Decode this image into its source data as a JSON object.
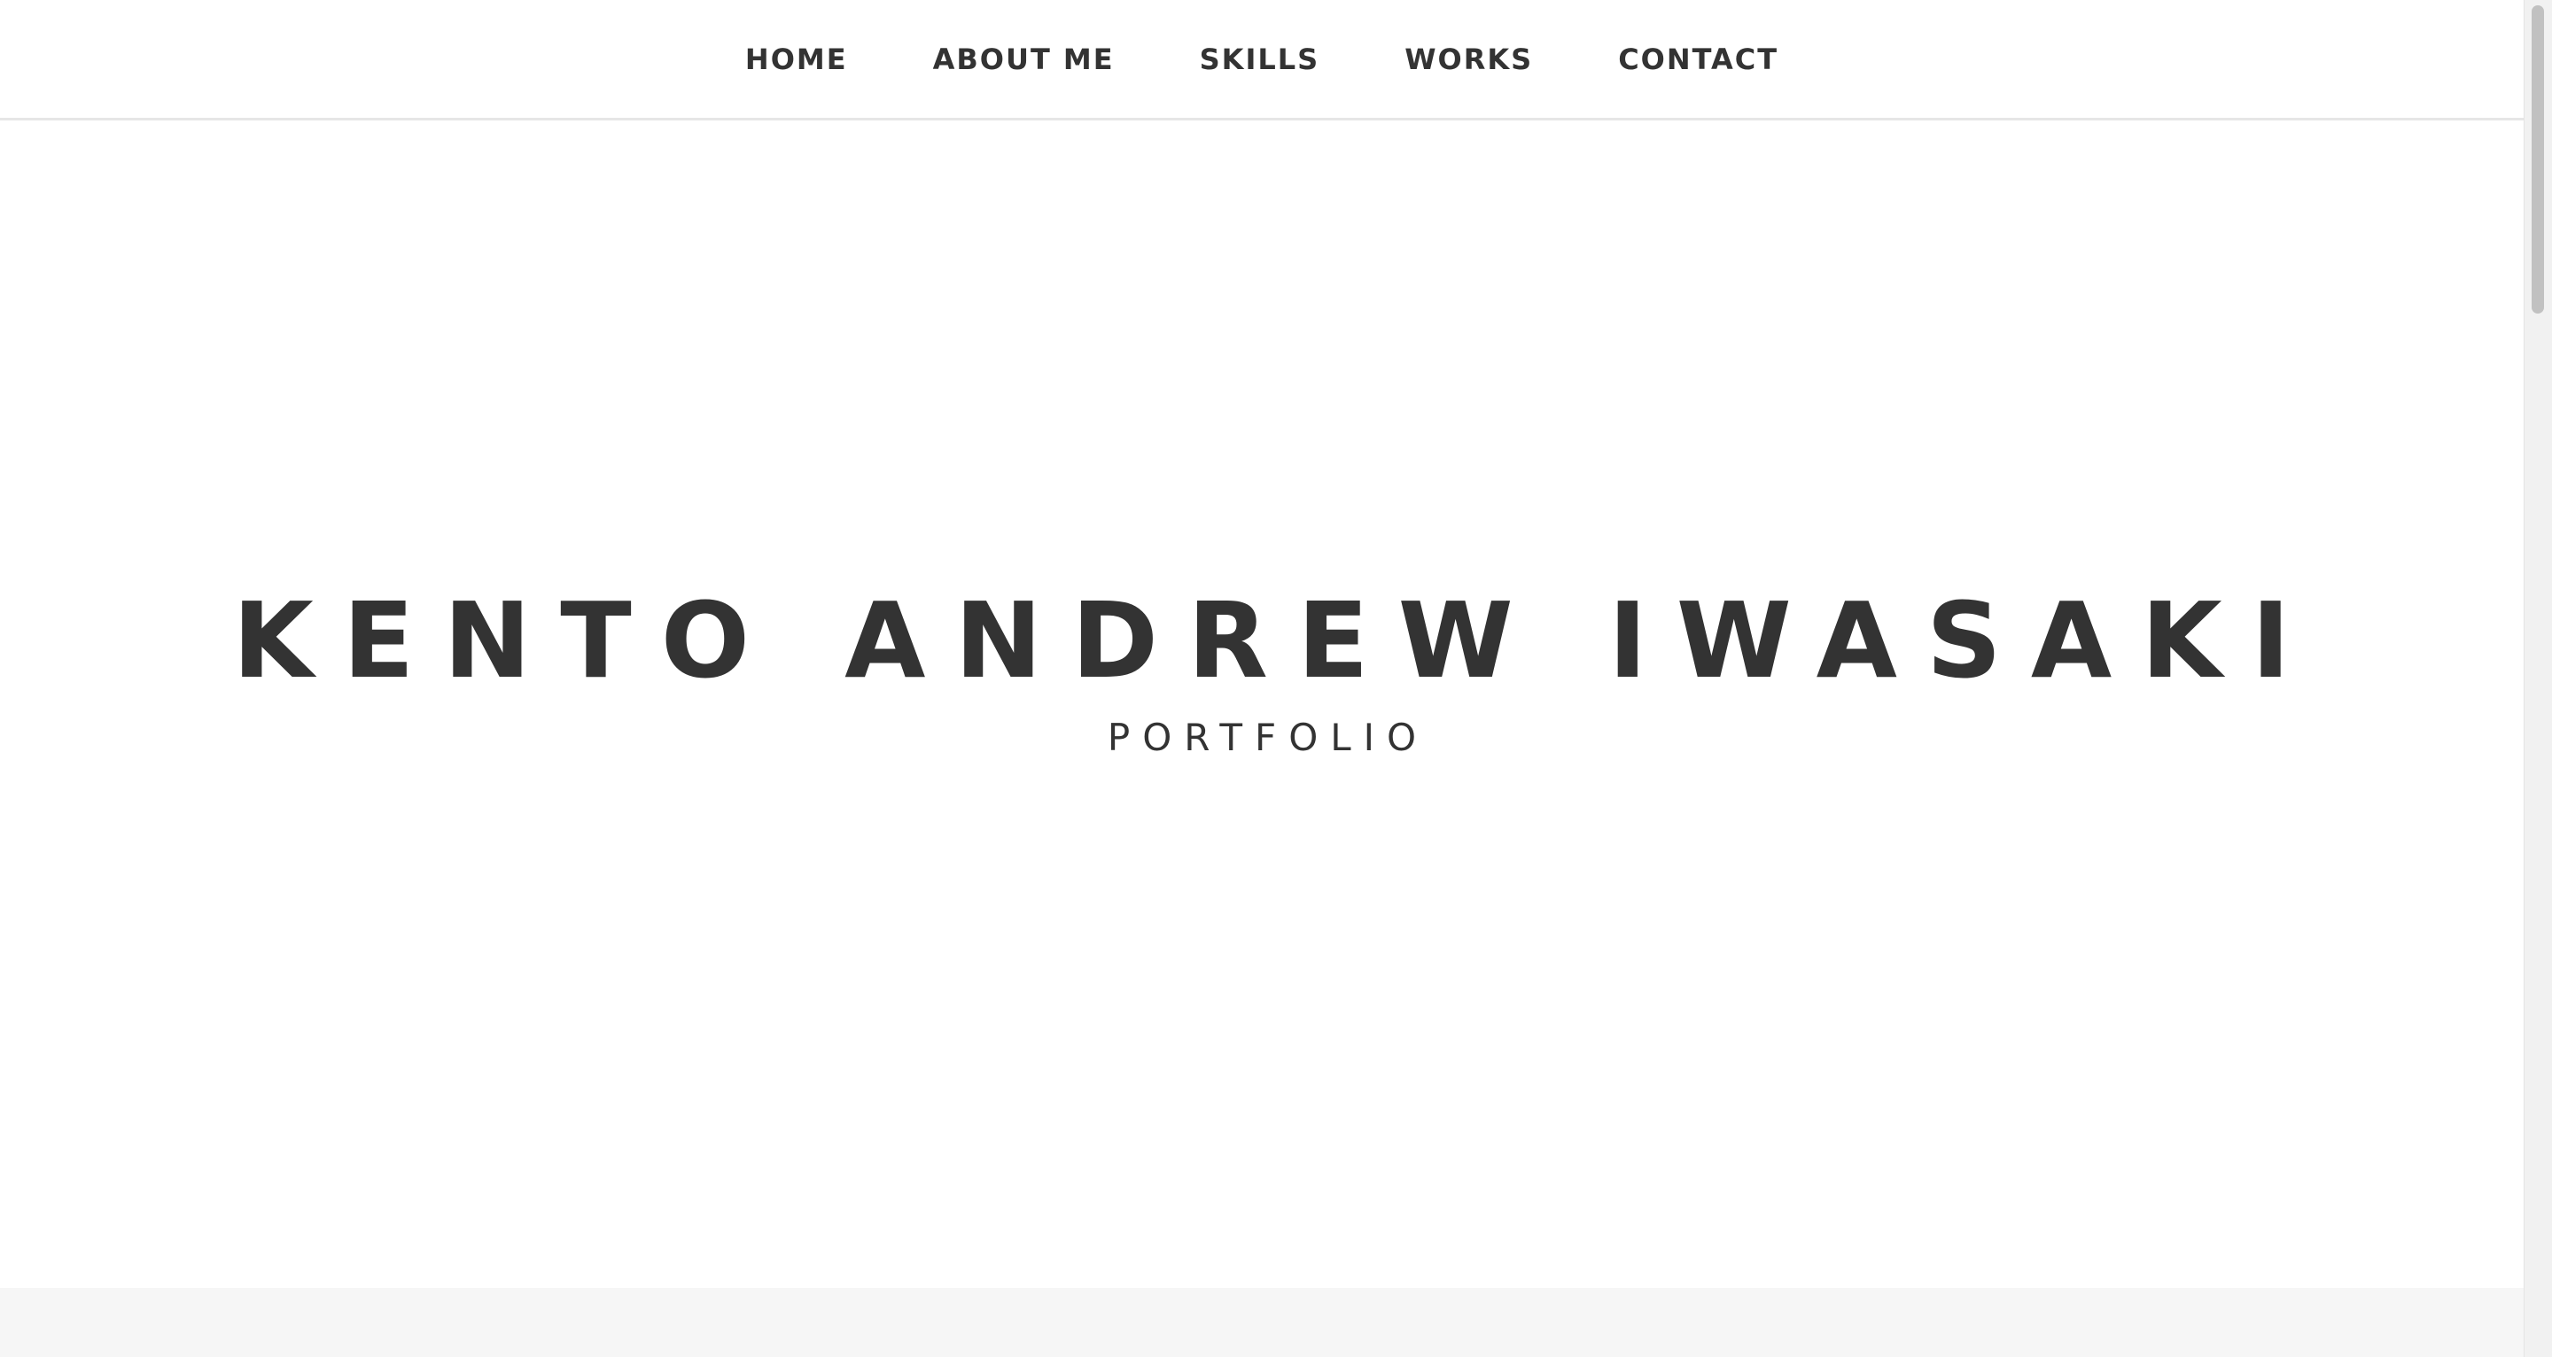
{
  "nav": {
    "items": [
      {
        "label": "HOME"
      },
      {
        "label": "ABOUT ME"
      },
      {
        "label": "SKILLS"
      },
      {
        "label": "WORKS"
      },
      {
        "label": "CONTACT"
      }
    ]
  },
  "hero": {
    "title": "KENTO ANDREW IWASAKI",
    "subtitle": "PORTFOLIO"
  },
  "colors": {
    "text": "#333333",
    "background": "#ffffff",
    "next_section_bg": "#f6f6f6",
    "nav_border": "#e6e6e6",
    "scrollbar_thumb": "#c1c1c1"
  }
}
